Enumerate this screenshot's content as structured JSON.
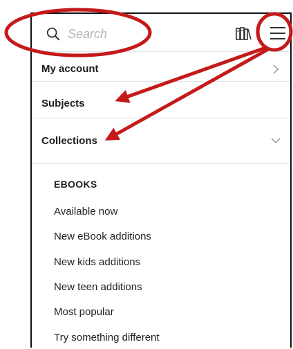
{
  "header": {
    "search_placeholder": "Search",
    "icons": [
      "search-icon",
      "bookshelf-icon",
      "hamburger-menu-icon"
    ]
  },
  "menu": {
    "items": [
      {
        "label": "My account",
        "indicator": "chevron-right-icon"
      },
      {
        "label": "Subjects"
      },
      {
        "label": "Collections",
        "indicator": "chevron-down-icon"
      }
    ],
    "collections": {
      "heading": "EBOOKS",
      "links": [
        "Available now",
        "New eBook additions",
        "New kids additions",
        "New teen additions",
        "Most popular",
        "Try something different"
      ]
    }
  },
  "annotation_color": "#c41a1a"
}
